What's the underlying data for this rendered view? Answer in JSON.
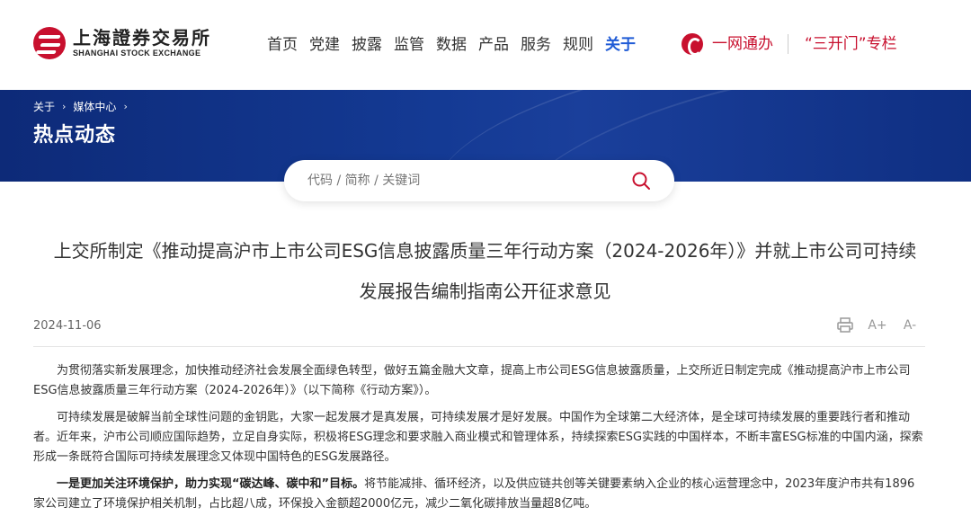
{
  "logo": {
    "name_cn": "上海證券交易所",
    "name_en": "SHANGHAI STOCK EXCHANGE"
  },
  "nav": {
    "items": [
      "首页",
      "党建",
      "披露",
      "监管",
      "数据",
      "产品",
      "服务",
      "规则",
      "关于"
    ],
    "active": "关于"
  },
  "header_links": {
    "ywtb": "一网通办",
    "skm": "“三开门”专栏"
  },
  "breadcrumb": [
    "关于",
    "媒体中心"
  ],
  "banner": {
    "title": "热点动态"
  },
  "search": {
    "placeholder": "代码 / 简称 / 关键词"
  },
  "article": {
    "title_line1": "上交所制定《推动提高沪市上市公司ESG信息披露质量三年行动方案（2024-2026年）》并就上市公司可持续",
    "title_line2": "发展报告编制指南公开征求意见",
    "date": "2024-11-06",
    "tools": {
      "print": "打印",
      "font_up": "A+",
      "font_down": "A-"
    },
    "para1": "为贯彻落实新发展理念，加快推动经济社会发展全面绿色转型，做好五篇金融大文章，提高上市公司ESG信息披露质量，上交所近日制定完成《推动提高沪市上市公司ESG信息披露质量三年行动方案（2024-2026年）》（以下简称《行动方案》）。",
    "para2": "可持续发展是破解当前全球性问题的金钥匙，大家一起发展才是真发展，可持续发展才是好发展。中国作为全球第二大经济体，是全球可持续发展的重要践行者和推动者。近年来，沪市公司顺应国际趋势，立足自身实际，积极将ESG理念和要求融入商业模式和管理体系，持续探索ESG实践的中国样本，不断丰富ESG标准的中国内涵，探索形成一条既符合国际可持续发展理念又体现中国特色的ESG发展路径。",
    "para3_bold": "一是更加关注环境保护，助力实现“碳达峰、碳中和”目标。",
    "para3_rest": "将节能减排、循环经济，以及供应链共创等关键要素纳入企业的核心运营理念中，2023年度沪市共有1896家公司建立了环境保护相关机制，占比超八成，环保投入金额超2000亿元，减少二氧化碳排放当量超8亿吨。"
  },
  "colors": {
    "brand_red": "#c8102e",
    "nav_active": "#1f5bd6",
    "banner_blue": "#143a94"
  }
}
